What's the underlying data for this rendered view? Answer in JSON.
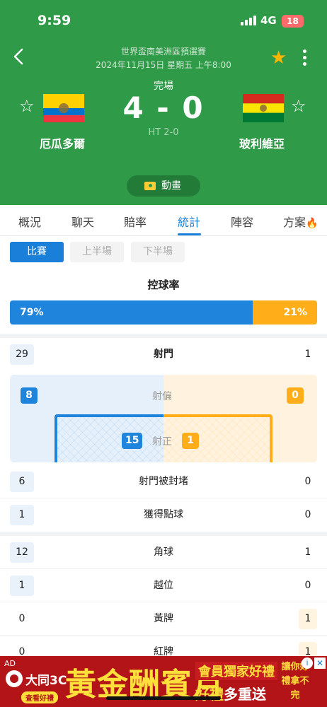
{
  "status_bar": {
    "time": "9:59",
    "network": "4G",
    "battery": "18"
  },
  "header": {
    "competition": "世界盃南美洲區預選賽",
    "date": "2024年11月15日 星期五 上午8:00",
    "match_status": "完場",
    "score": "4 - 0",
    "halftime": "HT 2-0",
    "home_team": "厄瓜多爾",
    "away_team": "玻利維亞",
    "animation_label": "動畫",
    "favorite_icon": "star-icon",
    "colors": {
      "header_bg": "#2f9a48",
      "favorite": "#ffb400"
    }
  },
  "tabs": [
    "概況",
    "聊天",
    "賠率",
    "統計",
    "陣容",
    "方案"
  ],
  "active_tab": "統計",
  "periods": [
    "比賽",
    "上半場",
    "下半場"
  ],
  "active_period": "比賽",
  "possession": {
    "title": "控球率",
    "home": "79%",
    "away": "21%",
    "home_value": 79,
    "away_value": 21
  },
  "shots": {
    "total": {
      "home": "29",
      "label": "射門",
      "away": "1"
    },
    "off_target": {
      "home": "8",
      "label": "射偏",
      "away": "0"
    },
    "on_target": {
      "home": "15",
      "label": "射正",
      "away": "1"
    }
  },
  "stats": [
    {
      "home": "6",
      "label": "射門被封堵",
      "away": "0"
    },
    {
      "home": "1",
      "label": "獲得點球",
      "away": "0"
    },
    {
      "home": "12",
      "label": "角球",
      "away": "1"
    },
    {
      "home": "1",
      "label": "越位",
      "away": "0"
    },
    {
      "home": "0",
      "label": "黃牌",
      "away": "1"
    },
    {
      "home": "0",
      "label": "紅牌",
      "away": "1"
    }
  ],
  "ad": {
    "tag": "AD",
    "brand": "大同3C",
    "sub": "查看好禮",
    "headline": "黃金酬賓月",
    "line1": "會員獨家好禮",
    "line2_a": "好禮",
    "line2_b": "多重送",
    "side": "讓你好禮拿不完"
  },
  "colors": {
    "home": "#1f84dc",
    "away": "#ffae1a",
    "accent": "#1a7fd8"
  }
}
